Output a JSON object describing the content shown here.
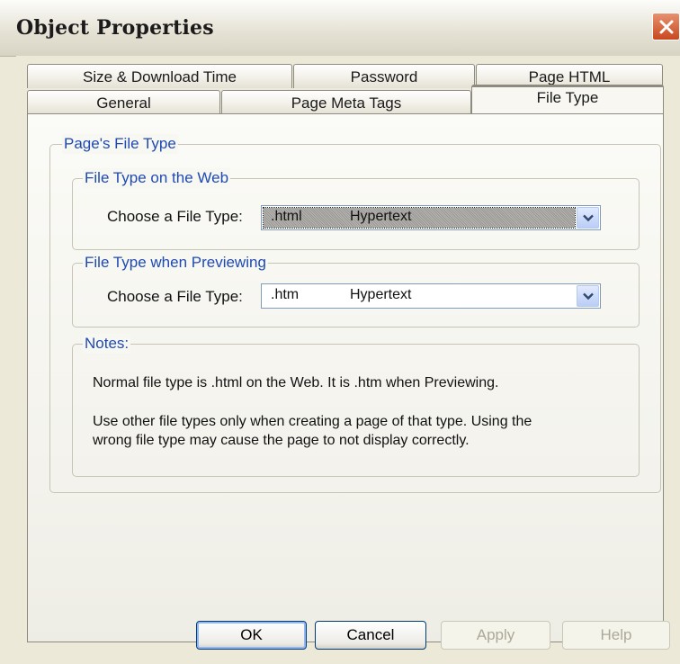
{
  "window": {
    "title": "Object Properties"
  },
  "tabs": {
    "back_row": [
      "Size & Download Time",
      "Password",
      "Page HTML"
    ],
    "front_row": [
      "General",
      "Page Meta Tags",
      "File Type"
    ],
    "active": "File Type"
  },
  "panel": {
    "group_title": "Page's File Type",
    "web": {
      "title": "File Type on the Web",
      "label": "Choose a File Type:",
      "selected_ext": ".html",
      "selected_desc": "Hypertext"
    },
    "preview": {
      "title": "File Type when Previewing",
      "label": "Choose a File Type:",
      "selected_ext": ".htm",
      "selected_desc": "Hypertext"
    },
    "notes": {
      "title": "Notes:",
      "line1": "Normal file type is .html on the Web. It is  .htm when Previewing.",
      "line2": "Use other file types only when creating a page of that type. Using the",
      "line3": "wrong file type may cause the page to not display correctly."
    }
  },
  "buttons": {
    "ok": "OK",
    "cancel": "Cancel",
    "apply": "Apply",
    "help": "Help"
  },
  "icons": {
    "close": "close-icon",
    "dropdown": "chevron-down-icon"
  },
  "colors": {
    "accent_tab": "#f2a326",
    "legend_text": "#1f49b4",
    "close_button": "#c8471e"
  }
}
